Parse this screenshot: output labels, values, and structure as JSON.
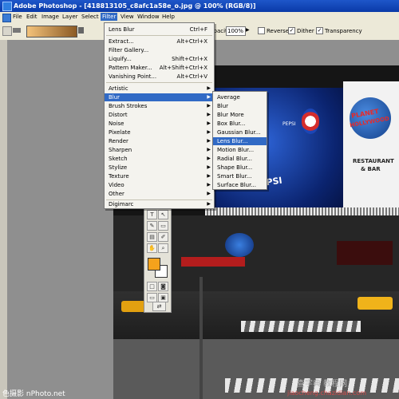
{
  "window": {
    "title": "Adobe Photoshop - [418813105_c8afc1a58e_o.jpg @ 100% (RGB/8)]"
  },
  "menubar": {
    "items": [
      "File",
      "Edit",
      "Image",
      "Layer",
      "Select",
      "Filter",
      "View",
      "Window",
      "Help"
    ],
    "active": "Filter"
  },
  "options_bar": {
    "opacity_label": "Opacity:",
    "opacity_value": "100%",
    "reverse_label": "Reverse",
    "reverse_checked": false,
    "dither_label": "Dither",
    "dither_checked": true,
    "transparency_label": "Transparency",
    "transparency_checked": true
  },
  "filter_menu": {
    "top_items": [
      {
        "label": "Lens Blur",
        "shortcut": "Ctrl+F"
      }
    ],
    "utility_items": [
      {
        "label": "Extract...",
        "shortcut": "Alt+Ctrl+X"
      },
      {
        "label": "Filter Gallery...",
        "shortcut": ""
      },
      {
        "label": "Liquify...",
        "shortcut": "Shift+Ctrl+X"
      },
      {
        "label": "Pattern Maker...",
        "shortcut": "Alt+Shift+Ctrl+X"
      },
      {
        "label": "Vanishing Point...",
        "shortcut": "Alt+Ctrl+V"
      }
    ],
    "filter_items": [
      "Artistic",
      "Blur",
      "Brush Strokes",
      "Distort",
      "Noise",
      "Pixelate",
      "Render",
      "Sharpen",
      "Sketch",
      "Stylize",
      "Texture",
      "Video",
      "Other"
    ],
    "highlighted": "Blur",
    "bottom_items": [
      "Digimarc"
    ]
  },
  "blur_submenu": {
    "items": [
      "Average",
      "Blur",
      "Blur More",
      "Box Blur...",
      "Gaussian Blur...",
      "Lens Blur...",
      "Motion Blur...",
      "Radial Blur...",
      "Shape Blur...",
      "Smart Blur...",
      "Surface Blur..."
    ],
    "highlighted": "Lens Blur..."
  },
  "photo_text": {
    "billboard_left": "PEPSI",
    "billboard_can": "PEPSI",
    "sign_right_1": "PLANET",
    "sign_right_2": "HOLLYWOOD",
    "sign_right_3": "RESTAURANT",
    "sign_right_4": "& BAR"
  },
  "watermarks": {
    "bottom_left": "色摄影 nPhoto.net",
    "bottom_right_1": "查字典 教程网",
    "bottom_right_2": "jiaocheng.chazidian.com"
  },
  "colors": {
    "foreground": "#f4a21c",
    "background": "#ffffff",
    "menu_highlight": "#316ac5"
  }
}
